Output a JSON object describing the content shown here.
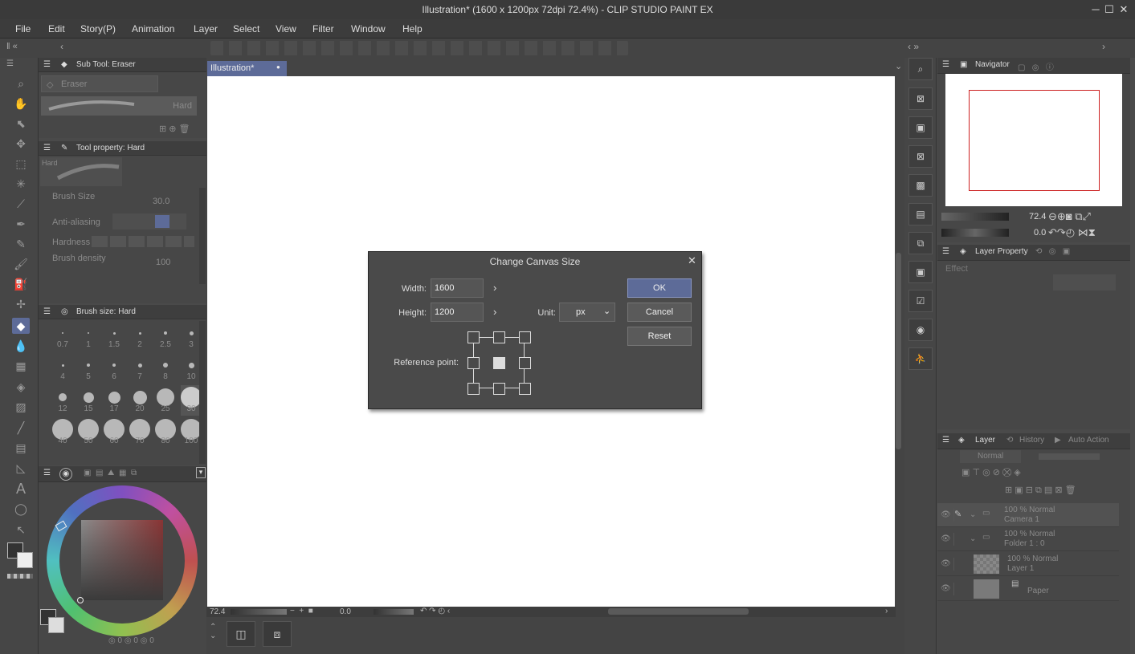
{
  "window": {
    "title": "Illustration* (1600 x 1200px 72dpi 72.4%)  - CLIP STUDIO PAINT EX",
    "minimize": "─",
    "maximize": "☐",
    "close": "✕"
  },
  "menu": [
    "File",
    "Edit",
    "Story(P)",
    "Animation",
    "Layer",
    "Select",
    "View",
    "Filter",
    "Window",
    "Help"
  ],
  "subtool": {
    "header": "Sub Tool: Eraser",
    "group": "Eraser",
    "brush": "Hard"
  },
  "toolprop": {
    "header": "Tool property: Hard",
    "brush_label": "Hard",
    "brush_size_label": "Brush Size",
    "brush_size_value": "30.0",
    "antialias_label": "Anti-aliasing",
    "hardness_label": "Hardness",
    "density_label": "Brush density",
    "density_value": "100"
  },
  "brushsize": {
    "header": "Brush size: Hard",
    "sizes": [
      "0.7",
      "1",
      "1.5",
      "2",
      "2.5",
      "3",
      "4",
      "5",
      "6",
      "7",
      "8",
      "10",
      "12",
      "15",
      "17",
      "20",
      "25",
      "30",
      "40",
      "50",
      "60",
      "70",
      "80",
      "100"
    ]
  },
  "color": {
    "bottom_values": [
      "0",
      "0",
      "0"
    ]
  },
  "canvas_tab": {
    "label": "Illustration*",
    "close": "●"
  },
  "statusbar": {
    "zoom": "72.4",
    "angle": "0.0"
  },
  "dialog": {
    "title": "Change Canvas Size",
    "width_label": "Width:",
    "width_value": "1600",
    "height_label": "Height:",
    "height_value": "1200",
    "unit_label": "Unit:",
    "unit_value": "px",
    "ref_label": "Reference point:",
    "ok": "OK",
    "cancel": "Cancel",
    "reset": "Reset"
  },
  "navigator": {
    "header": "Navigator",
    "zoom": "72.4",
    "angle": "0.0"
  },
  "layerprop": {
    "header": "Layer Property",
    "effect": "Effect"
  },
  "layerpanel": {
    "tabs": [
      "Layer",
      "History",
      "Auto Action"
    ],
    "blend": "Normal",
    "layers": [
      {
        "line1": "100 % Normal",
        "line2": "Camera 1"
      },
      {
        "line1": "100 % Normal",
        "line2": "Folder 1 : 0"
      },
      {
        "line1": "100 % Normal",
        "line2": "Layer 1"
      },
      {
        "line1": "",
        "line2": "Paper"
      }
    ]
  },
  "colors": {
    "accent": "#5d6b98",
    "red_frame": "#cc2020",
    "bg": "#4a4a4a"
  }
}
